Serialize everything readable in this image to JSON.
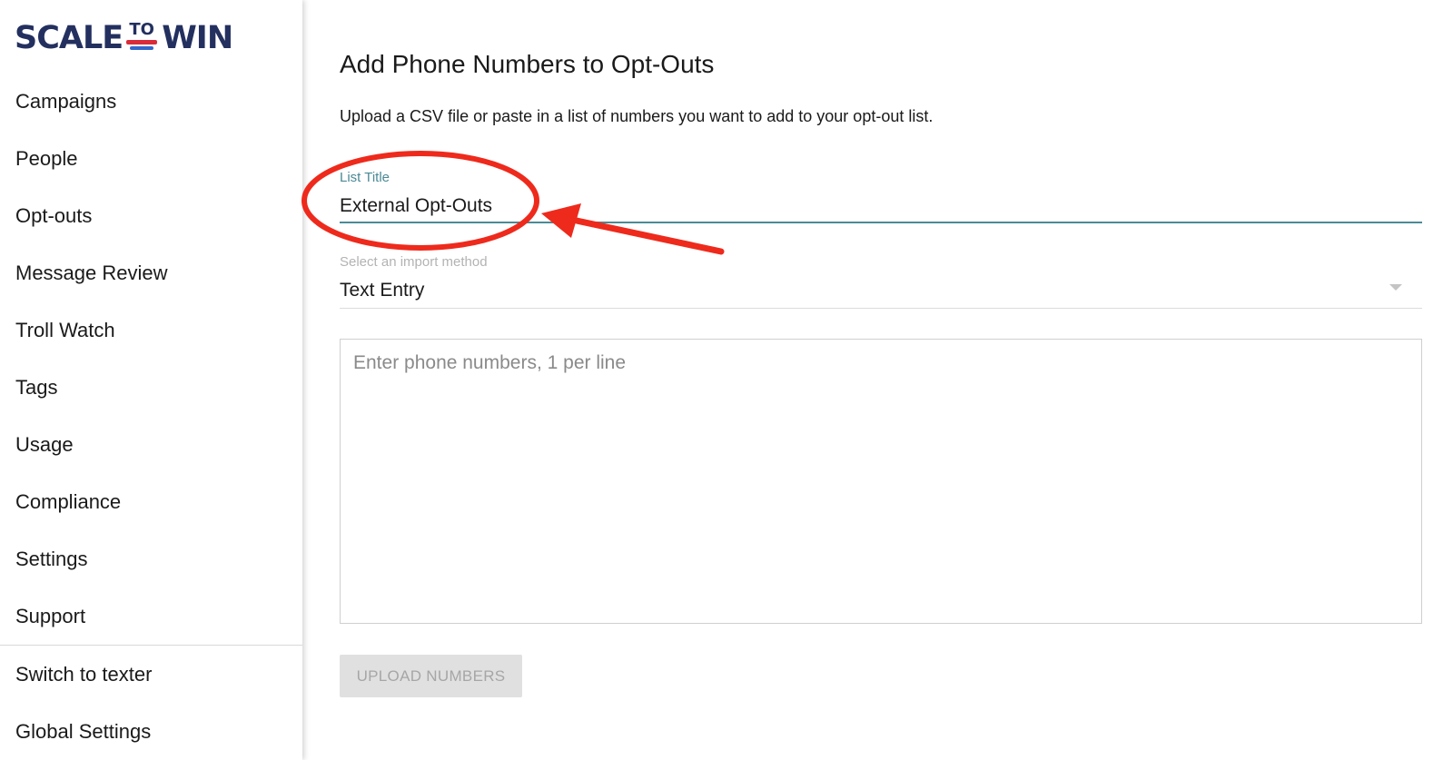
{
  "logo": {
    "word1": "SCALE",
    "word2": "TO",
    "word3": "WIN"
  },
  "sidebar": {
    "items": [
      {
        "label": "Campaigns"
      },
      {
        "label": "People"
      },
      {
        "label": "Opt-outs"
      },
      {
        "label": "Message Review"
      },
      {
        "label": "Troll Watch"
      },
      {
        "label": "Tags"
      },
      {
        "label": "Usage"
      },
      {
        "label": "Compliance"
      },
      {
        "label": "Settings"
      },
      {
        "label": "Support"
      }
    ],
    "footer_items": [
      {
        "label": "Switch to texter"
      },
      {
        "label": "Global Settings"
      }
    ]
  },
  "main": {
    "title": "Add Phone Numbers to Opt-Outs",
    "description": "Upload a CSV file or paste in a list of numbers you want to add to your opt-out list.",
    "list_title": {
      "label": "List Title",
      "value": "External Opt-Outs"
    },
    "import_method": {
      "label": "Select an import method",
      "value": "Text Entry"
    },
    "phone_input": {
      "placeholder": "Enter phone numbers, 1 per line",
      "value": ""
    },
    "upload_button": "UPLOAD NUMBERS"
  },
  "colors": {
    "brand_navy": "#23305f",
    "brand_red": "#d92b3a",
    "brand_blue": "#3467c9",
    "accent_teal": "#4a8a96",
    "annotation_red": "#ee2a1c",
    "button_disabled_bg": "#e0e0e0"
  },
  "icons": {
    "select_arrow": "caret-down-icon"
  }
}
